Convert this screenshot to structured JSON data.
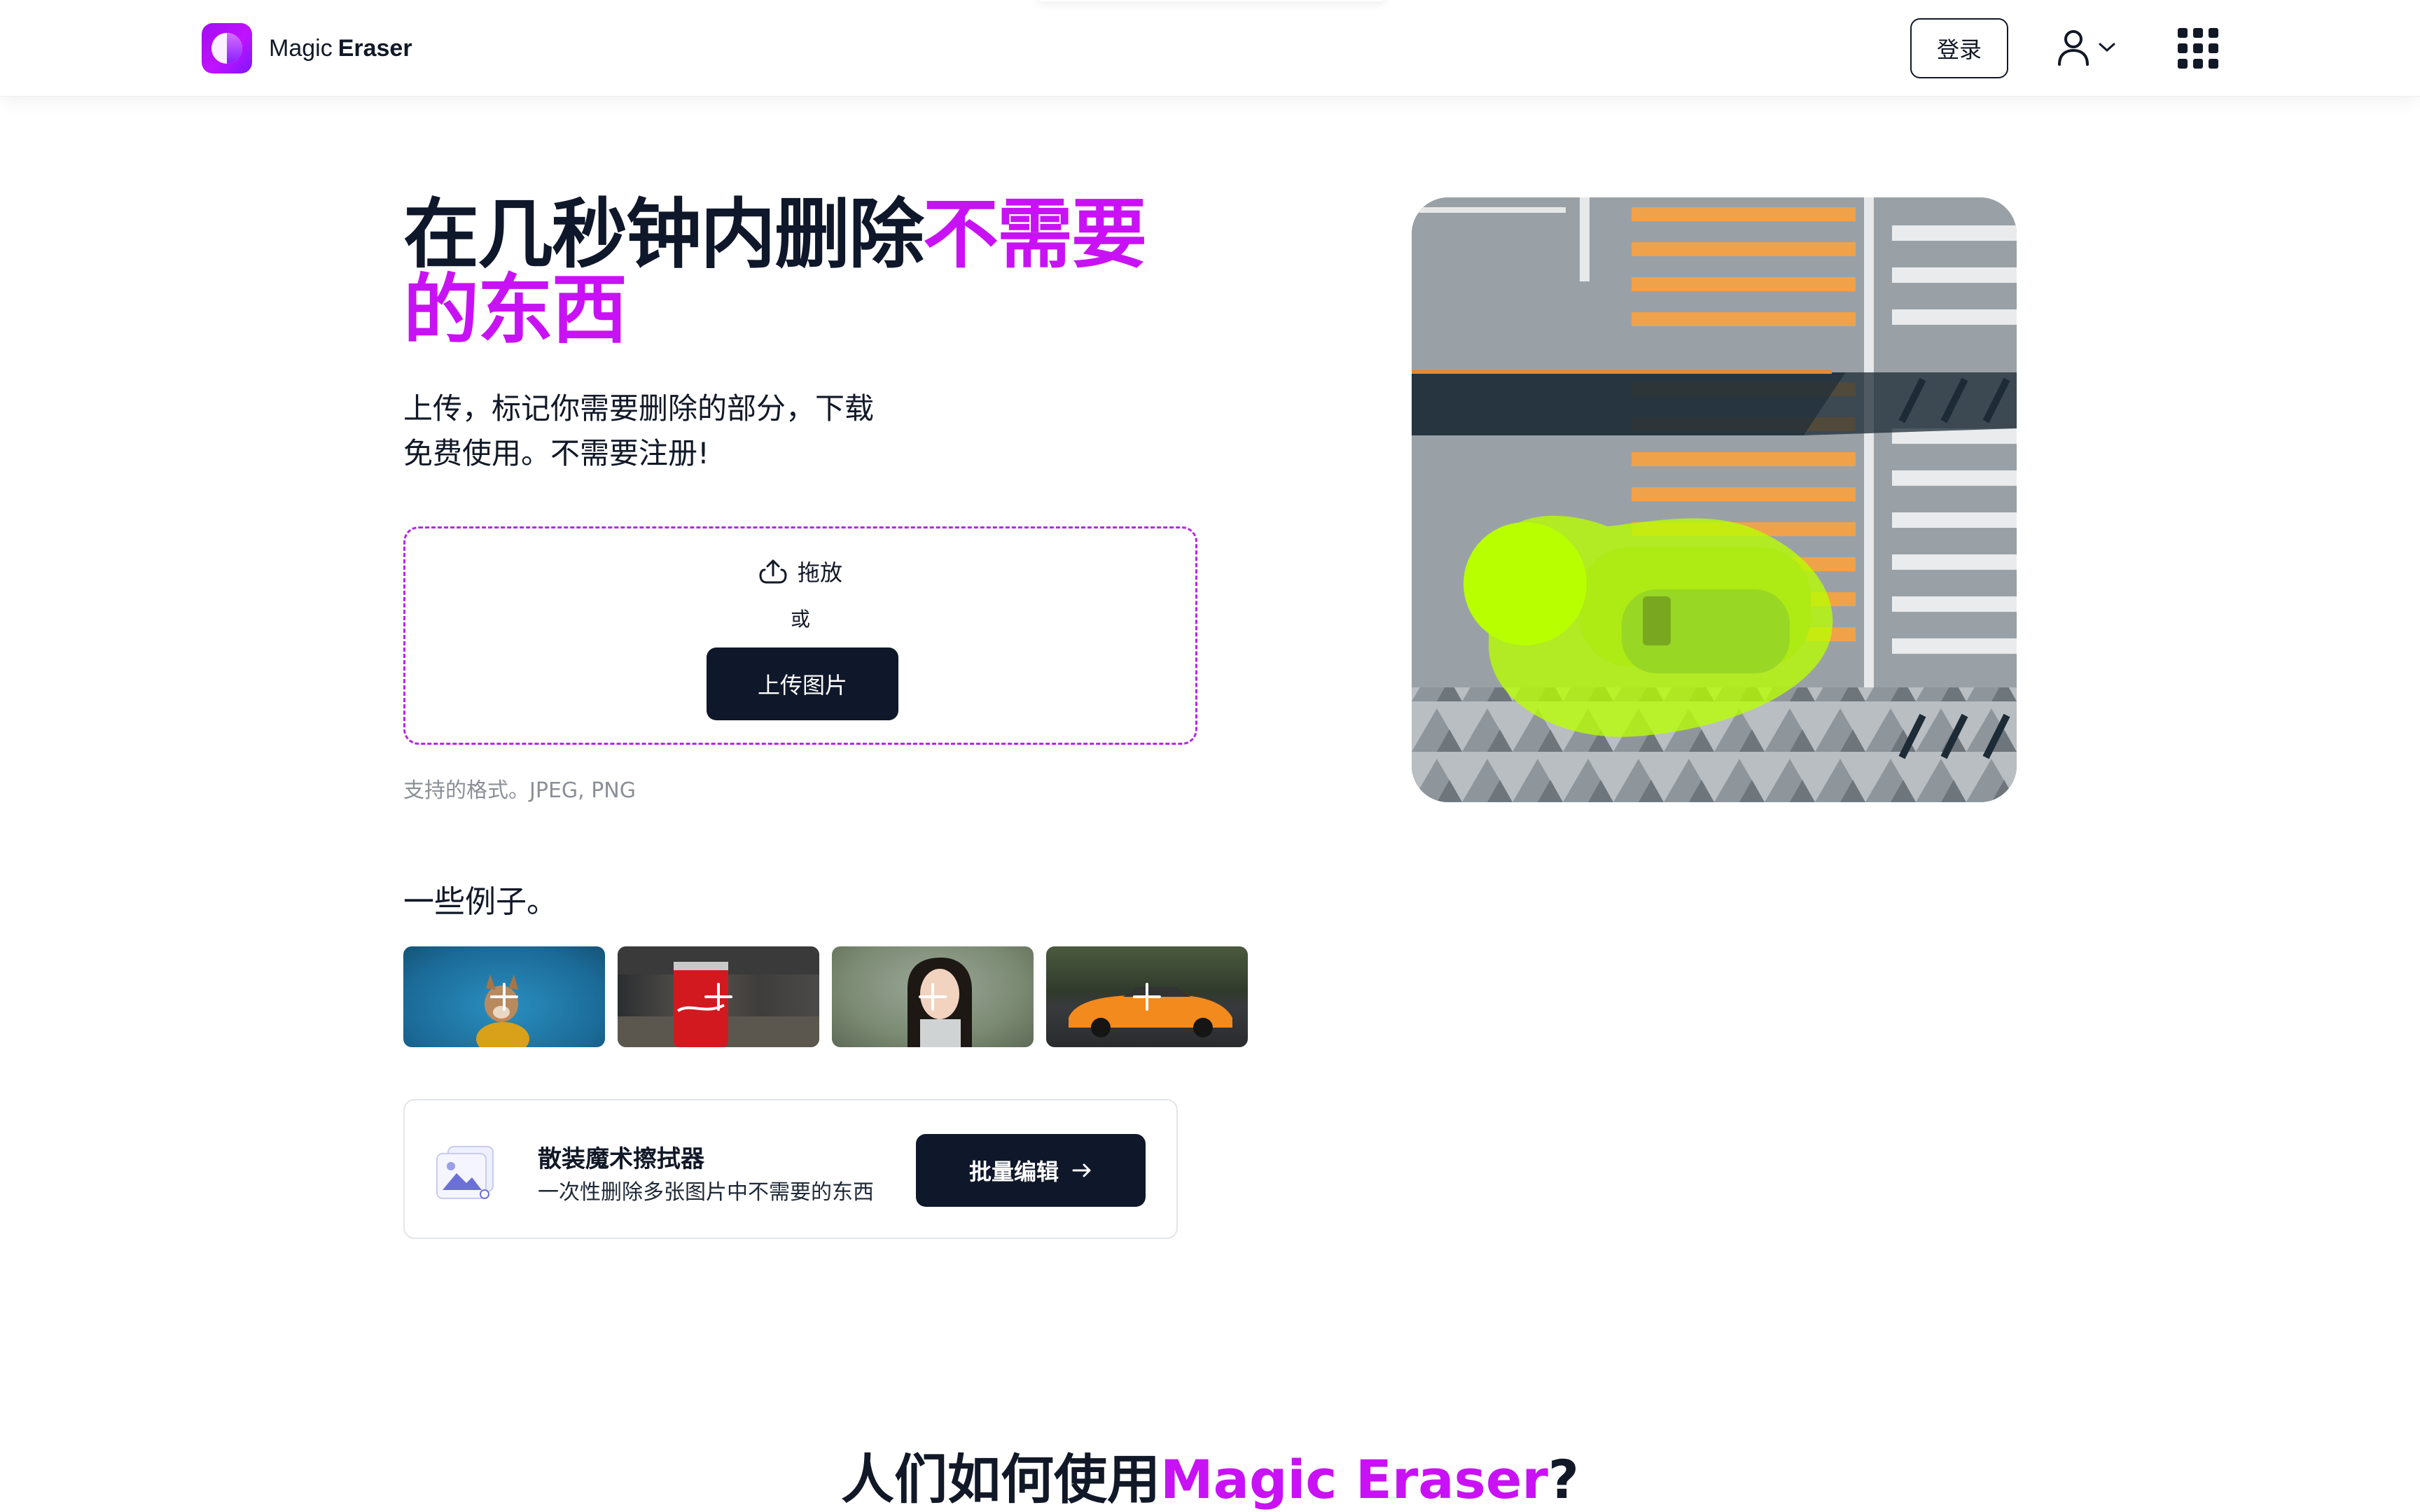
{
  "header": {
    "logo_word1": "Magic",
    "logo_word2": "Eraser",
    "login_label": "登录"
  },
  "hero": {
    "title_dark": "在几秒钟内删除",
    "title_accent_1": "不需要",
    "title_accent_2": "的东西",
    "subtitle_line1": "上传，标记你需要删除的部分，下载",
    "subtitle_line2": "免费使用。不需要注册!",
    "drop_label": "拖放",
    "or_label": "或",
    "upload_button": "上传图片",
    "formats_text": "支持的格式。JPEG, PNG"
  },
  "examples": {
    "title": "一些例子。",
    "items": [
      {
        "name": "dog"
      },
      {
        "name": "cola"
      },
      {
        "name": "woman"
      },
      {
        "name": "car"
      }
    ]
  },
  "batch": {
    "title": "散装魔术擦拭器",
    "description": "一次性删除多张图片中不需要的东西",
    "button_label": "批量编辑"
  },
  "how": {
    "title_dark": "人们如何使用",
    "title_accent": "Magic Eraser",
    "title_end": "?"
  },
  "colors": {
    "accent": "#c812f5",
    "dark": "#0f172a",
    "highlight": "#b8ff00"
  }
}
